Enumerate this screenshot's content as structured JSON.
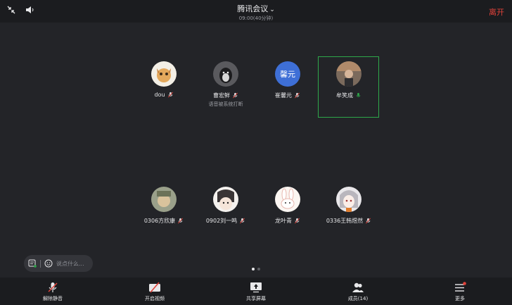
{
  "header": {
    "title": "腾讯会议",
    "subtitle": "09:00(40分钟)",
    "leave_label": "离开"
  },
  "participants": [
    {
      "name": "dou",
      "avatar": "cartoon-dog-avatar",
      "mic": "muted"
    },
    {
      "name": "曹宏鲜",
      "avatar": "penguin-avatar",
      "mic": "muted",
      "note": "语音被系统打断"
    },
    {
      "name": "崔馨元",
      "avatar_text": "馨元",
      "mic": "muted"
    },
    {
      "name": "牟笑成",
      "avatar": "photo-avatar",
      "mic": "speaking"
    },
    {
      "name": "0306方欣康",
      "avatar": "photo-avatar",
      "mic": "muted"
    },
    {
      "name": "0902刘一鸣",
      "avatar": "anime-avatar",
      "mic": "muted"
    },
    {
      "name": "龙叶青",
      "avatar": "bunny-avatar",
      "mic": "muted"
    },
    {
      "name": "0336王韩煜然",
      "avatar": "anime-avatar",
      "mic": "muted"
    }
  ],
  "chat": {
    "placeholder": "说点什么..."
  },
  "pagination": {
    "total": 2,
    "current": 1
  },
  "toolbar": {
    "unmute_label": "解除静音",
    "video_label": "开启视频",
    "share_label": "共享屏幕",
    "members_label": "成员(14)",
    "more_label": "更多"
  },
  "colors": {
    "accent_speaking": "#2ea84a",
    "leave": "#e1423a",
    "avatar_text_bg": "#3e6fd6"
  }
}
